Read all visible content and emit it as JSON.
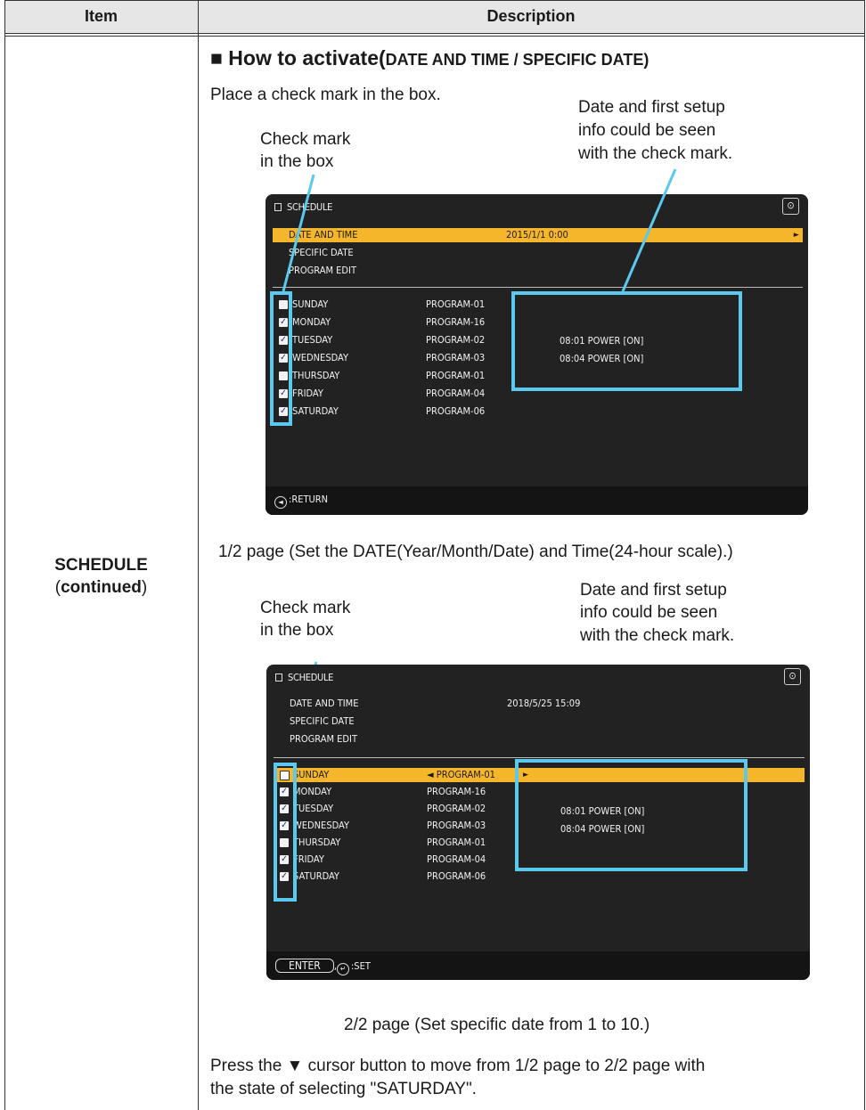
{
  "table": {
    "col_item": "Item",
    "col_description": "Description",
    "item_name": "SCHEDULE",
    "item_continued": "continued"
  },
  "section": {
    "title_main": "■ How to activate(",
    "title_detail": "DATE AND TIME / SPECIFIC DATE)",
    "instruction": "Place a check mark in the box."
  },
  "annotations": {
    "checkmark_line1": "Check mark",
    "checkmark_line2": "in the box",
    "info_line1": "Date and first setup",
    "info_line2": "info could be seen",
    "info_line3": "with the check mark."
  },
  "screen1": {
    "title": "SCHEDULE",
    "menu": [
      {
        "label": "DATE AND TIME",
        "value": "2015/1/1  0:00",
        "arrow": "►"
      },
      {
        "label": "SPECIFIC DATE"
      },
      {
        "label": "PROGRAM EDIT"
      }
    ],
    "days": [
      {
        "day": "SUNDAY",
        "program": "PROGRAM-01",
        "checked": false
      },
      {
        "day": "MONDAY",
        "program": "PROGRAM-16",
        "checked": true
      },
      {
        "day": "TUESDAY",
        "program": "PROGRAM-02",
        "checked": true
      },
      {
        "day": "WEDNESDAY",
        "program": "PROGRAM-03",
        "checked": true
      },
      {
        "day": "THURSDAY",
        "program": "PROGRAM-01",
        "checked": false
      },
      {
        "day": "FRIDAY",
        "program": "PROGRAM-04",
        "checked": true
      },
      {
        "day": "SATURDAY",
        "program": "PROGRAM-06",
        "checked": true
      }
    ],
    "info": [
      "08:01  POWER [ON]",
      "08:04  POWER [ON]"
    ],
    "footer": ":RETURN"
  },
  "caption1": "1/2 page (Set the DATE(Year/Month/Date) and Time(24-hour scale).)",
  "screen2": {
    "title": "SCHEDULE",
    "menu": [
      {
        "label": "DATE AND TIME",
        "value": "2018/5/25 15:09"
      },
      {
        "label": "SPECIFIC DATE"
      },
      {
        "label": "PROGRAM EDIT"
      }
    ],
    "days": [
      {
        "day": "SUNDAY",
        "program": "◄ PROGRAM-01",
        "checked": false,
        "arrow": "►"
      },
      {
        "day": "MONDAY",
        "program": "PROGRAM-16",
        "checked": true
      },
      {
        "day": "TUESDAY",
        "program": "PROGRAM-02",
        "checked": true
      },
      {
        "day": "WEDNESDAY",
        "program": "PROGRAM-03",
        "checked": true
      },
      {
        "day": "THURSDAY",
        "program": "PROGRAM-01",
        "checked": false
      },
      {
        "day": "FRIDAY",
        "program": "PROGRAM-04",
        "checked": true
      },
      {
        "day": "SATURDAY",
        "program": "PROGRAM-06",
        "checked": true
      }
    ],
    "info": [
      "08:01  POWER [ON]",
      "08:04  POWER [ON]"
    ],
    "footer_enter": "ENTER",
    "footer_set": ":SET"
  },
  "caption2": "2/2 page (Set specific date from 1 to 10.)",
  "note_line1": "Press the ▼ cursor button to move from 1/2 page to 2/2 page with",
  "note_line2": "the state of selecting \"SATURDAY\".",
  "colors": {
    "highlight": "#f5b62c",
    "callout": "#5bc8ee",
    "screen_bg": "#222222"
  }
}
